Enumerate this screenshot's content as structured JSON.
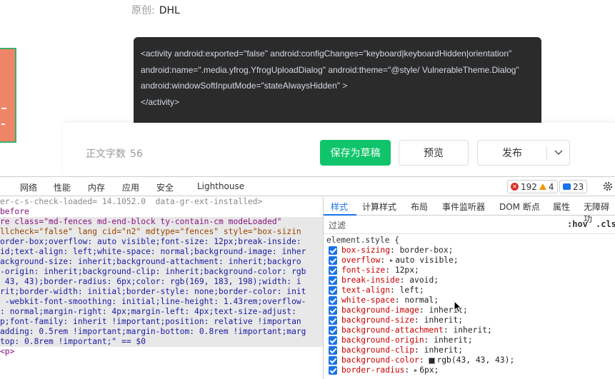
{
  "page": {
    "original_label": "原创:",
    "author": "DHL",
    "code_lines": [
      "<activity android:exported=\"false\" android:configChanges=\"keyboard|keyboardHidden|orientation\"",
      "android:name=\".media.yfrog.YfrogUploadDialog\" android:theme=\"@style/ VulnerableTheme.Dialog\"",
      "android:windowSoftInputMode=\"stateAlwaysHidden\" >",
      "",
      "</activity>"
    ],
    "word_count_label": "正文字数",
    "word_count": "56",
    "save_draft_label": "保存为草稿",
    "preview_label": "预览",
    "publish_label": "发布"
  },
  "devtools": {
    "tabs": [
      "网络",
      "性能",
      "内存",
      "应用",
      "安全",
      "Lighthouse"
    ],
    "errors": "192",
    "warnings": "4",
    "messages": "23",
    "styles_tabs": [
      "样式",
      "计算样式",
      "布局",
      "事件监听器",
      "DOM 断点",
      "属性",
      "无障碍功"
    ],
    "filter_placeholder": "过滤",
    "hov": ":hov",
    "cls": ".cls",
    "rule_selector": "element.style {",
    "properties": [
      {
        "name": "box-sizing",
        "value": "border-box;"
      },
      {
        "name": "overflow",
        "value": "auto visible;",
        "expandable": true
      },
      {
        "name": "font-size",
        "value": "12px;"
      },
      {
        "name": "break-inside",
        "value": "avoid;"
      },
      {
        "name": "text-align",
        "value": "left;"
      },
      {
        "name": "white-space",
        "value": "normal;"
      },
      {
        "name": "background-image",
        "value": "inherit;"
      },
      {
        "name": "background-size",
        "value": "inherit;"
      },
      {
        "name": "background-attachment",
        "value": "inherit;"
      },
      {
        "name": "background-origin",
        "value": "inherit;"
      },
      {
        "name": "background-clip",
        "value": "inherit;"
      },
      {
        "name": "background-color",
        "value": "rgb(43, 43, 43);",
        "swatch": true
      },
      {
        "name": "border-radius",
        "value": "6px;",
        "expandable": true
      }
    ],
    "elements_lines": [
      "er-c-s-check-loaded= 14.1052.0  data-gr-ext-installed>",
      "before",
      "re class=\"md-fences md-end-block ty-contain-cm modeLoaded\"",
      "llcheck=\"false\" lang cid=\"n2\" mdtype=\"fences\" style=\"box-sizin",
      "order-box;overflow: auto visible;font-size: 12px;break-inside:",
      "id;text-align: left;white-space: normal;background-image: inher",
      "ackground-size: inherit;background-attachment: inherit;backgro",
      "-origin: inherit;background-clip: inherit;background-color: rgb",
      " 43, 43);border-radius: 6px;color: rgb(169, 183, 198);width: i",
      "rit;border-width: initial;border-style: none;border-color: init",
      " -webkit-font-smoothing: initial;line-height: 1.43rem;overflow-",
      ": normal;margin-right: 4px;margin-left: 4px;text-size-adjust:",
      "p;font-family: inherit !important;position: relative !importan",
      "adding: 0.5rem !important;margin-bottom: 0.8rem !important;marg",
      "top: 0.8rem !important;\" == $0",
      "<p>"
    ]
  }
}
